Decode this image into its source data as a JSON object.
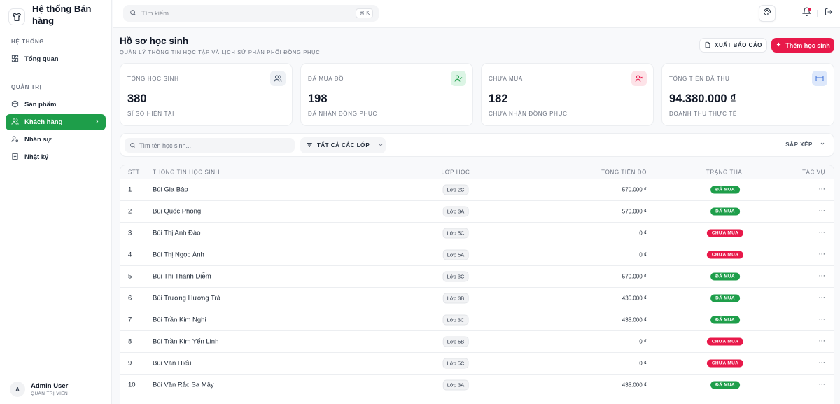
{
  "app": {
    "title": "Hệ thống Bán hàng"
  },
  "sidebar": {
    "sections": [
      {
        "title": "HỆ THỐNG",
        "items": [
          {
            "label": "Tổng quan",
            "icon": "dashboard-icon"
          }
        ]
      },
      {
        "title": "QUẢN TRỊ",
        "items": [
          {
            "label": "Sản phẩm",
            "icon": "package-icon"
          },
          {
            "label": "Khách hàng",
            "icon": "users-icon",
            "active": true
          },
          {
            "label": "Nhân sự",
            "icon": "user-cog-icon"
          },
          {
            "label": "Nhật ký",
            "icon": "log-icon"
          }
        ]
      }
    ],
    "user": {
      "initial": "A",
      "name": "Admin User",
      "role": "QUẢN TRỊ VIÊN"
    }
  },
  "topbar": {
    "search_placeholder": "Tìm kiếm...",
    "shortcut": "⌘ K"
  },
  "page": {
    "title": "Hồ sơ học sinh",
    "subtitle": "QUẢN LÝ THÔNG TIN HỌC TẬP VÀ LỊCH SỬ PHÂN PHỐI ĐỒNG PHỤC",
    "export_label": "XUẤT BÁO CÁO",
    "add_label": "Thêm học sinh"
  },
  "stats": [
    {
      "label": "TỔNG HỌC SINH",
      "value": "380",
      "note": "SĨ SỐ HIỆN TẠI",
      "icon": "users-icon",
      "icon_bg": "#eef1f5",
      "icon_color": "#475569"
    },
    {
      "label": "ĐÃ MUA ĐỒ",
      "value": "198",
      "note": "ĐÃ NHẬN ĐỒNG PHỤC",
      "icon": "user-check-icon",
      "icon_bg": "#dcf5e5",
      "icon_color": "#1e9e4a"
    },
    {
      "label": "CHƯA MUA",
      "value": "182",
      "note": "CHƯA NHẬN ĐỒNG PHỤC",
      "icon": "user-x-icon",
      "icon_bg": "#fde3e8",
      "icon_color": "#e8194a"
    },
    {
      "label": "TỔNG TIỀN ĐÃ THU",
      "value": "94.380.000 ₫",
      "note": "DOANH THU THỰC TẾ",
      "icon": "credit-card-icon",
      "icon_bg": "#dde8fb",
      "icon_color": "#3b6fd8"
    }
  ],
  "filters": {
    "search_placeholder": "Tìm tên học sinh...",
    "class_label": "TẤT CẢ CÁC LỚP",
    "sort_label": "SẮP XẾP"
  },
  "table": {
    "columns": [
      "STT",
      "THÔNG TIN HỌC SINH",
      "LỚP HỌC",
      "TỔNG TIỀN ĐỒ",
      "TRẠNG THÁI",
      "TÁC VỤ"
    ],
    "rows": [
      {
        "stt": "1",
        "name": "Bùi Gia Bảo",
        "class": "Lớp 2C",
        "total": "570.000 ₫",
        "status": "ĐÃ MUA",
        "paid": true
      },
      {
        "stt": "2",
        "name": "Bùi Quốc Phong",
        "class": "Lớp 3A",
        "total": "570.000 ₫",
        "status": "ĐÃ MUA",
        "paid": true
      },
      {
        "stt": "3",
        "name": "Bùi Thị Anh Đào",
        "class": "Lớp 5C",
        "total": "0 ₫",
        "status": "CHƯA MUA",
        "paid": false
      },
      {
        "stt": "4",
        "name": "Bùi Thị Ngọc Ánh",
        "class": "Lớp 5A",
        "total": "0 ₫",
        "status": "CHƯA MUA",
        "paid": false
      },
      {
        "stt": "5",
        "name": "Bùi Thị Thanh Diễm",
        "class": "Lớp 3C",
        "total": "570.000 ₫",
        "status": "ĐÃ MUA",
        "paid": true
      },
      {
        "stt": "6",
        "name": "Bùi Trương Hương Trà",
        "class": "Lớp 3B",
        "total": "435.000 ₫",
        "status": "ĐÃ MUA",
        "paid": true
      },
      {
        "stt": "7",
        "name": "Bùi Trần Kim Nghi",
        "class": "Lớp 3C",
        "total": "435.000 ₫",
        "status": "ĐÃ MUA",
        "paid": true
      },
      {
        "stt": "8",
        "name": "Bùi Trần Kim Yến Linh",
        "class": "Lớp 5B",
        "total": "0 ₫",
        "status": "CHƯA MUA",
        "paid": false
      },
      {
        "stt": "9",
        "name": "Bùi Văn Hiếu",
        "class": "Lớp 5C",
        "total": "0 ₫",
        "status": "CHƯA MUA",
        "paid": false
      },
      {
        "stt": "10",
        "name": "Bùi Văn Rắc Sa Mây",
        "class": "Lớp 3A",
        "total": "435.000 ₫",
        "status": "ĐÃ MUA",
        "paid": true
      },
      {
        "stt": "",
        "name": "",
        "class": "",
        "total": "",
        "status": "",
        "paid": true
      }
    ],
    "action_glyph": "···"
  },
  "colors": {
    "accent_green": "#1e9e4a",
    "accent_red": "#e8194a"
  }
}
